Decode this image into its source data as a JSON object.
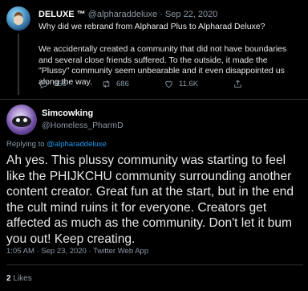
{
  "parent_tweet": {
    "display_name": "DELUXE ™",
    "handle": "@alpharaddeluxe",
    "separator": "·",
    "date": "Sep 22, 2020",
    "text_line1": "Why did we rebrand from Alpharad Plus to Alpharad Deluxe?",
    "text_line2": "We accidentally created a community that did not have boundaries and several close friends suffered. To the outside, it made the \"Plussy\" community seem unbearable and it even disappointed us along the way.",
    "replies_count": "356",
    "retweets_count": "686",
    "likes_count": "11.6K"
  },
  "reply_tweet": {
    "display_name": "Simcowking",
    "handle": "@Homeless_PharmD",
    "replying_label": "Replying to",
    "replying_to": "@alpharaddeluxe",
    "body": "Ah yes. This plussy community was starting to feel like the PHIJKCHU community surrounding another content creator. Great fun at the start, but in the end the cult mind ruins it for everyone. Creators get affected as much as the community. Don't let it bum you out! Keep creating.",
    "time": "1:05 AM",
    "date": "Sep 23, 2020",
    "source": "Twitter Web App",
    "likes_count": "2",
    "likes_label": "Likes"
  }
}
